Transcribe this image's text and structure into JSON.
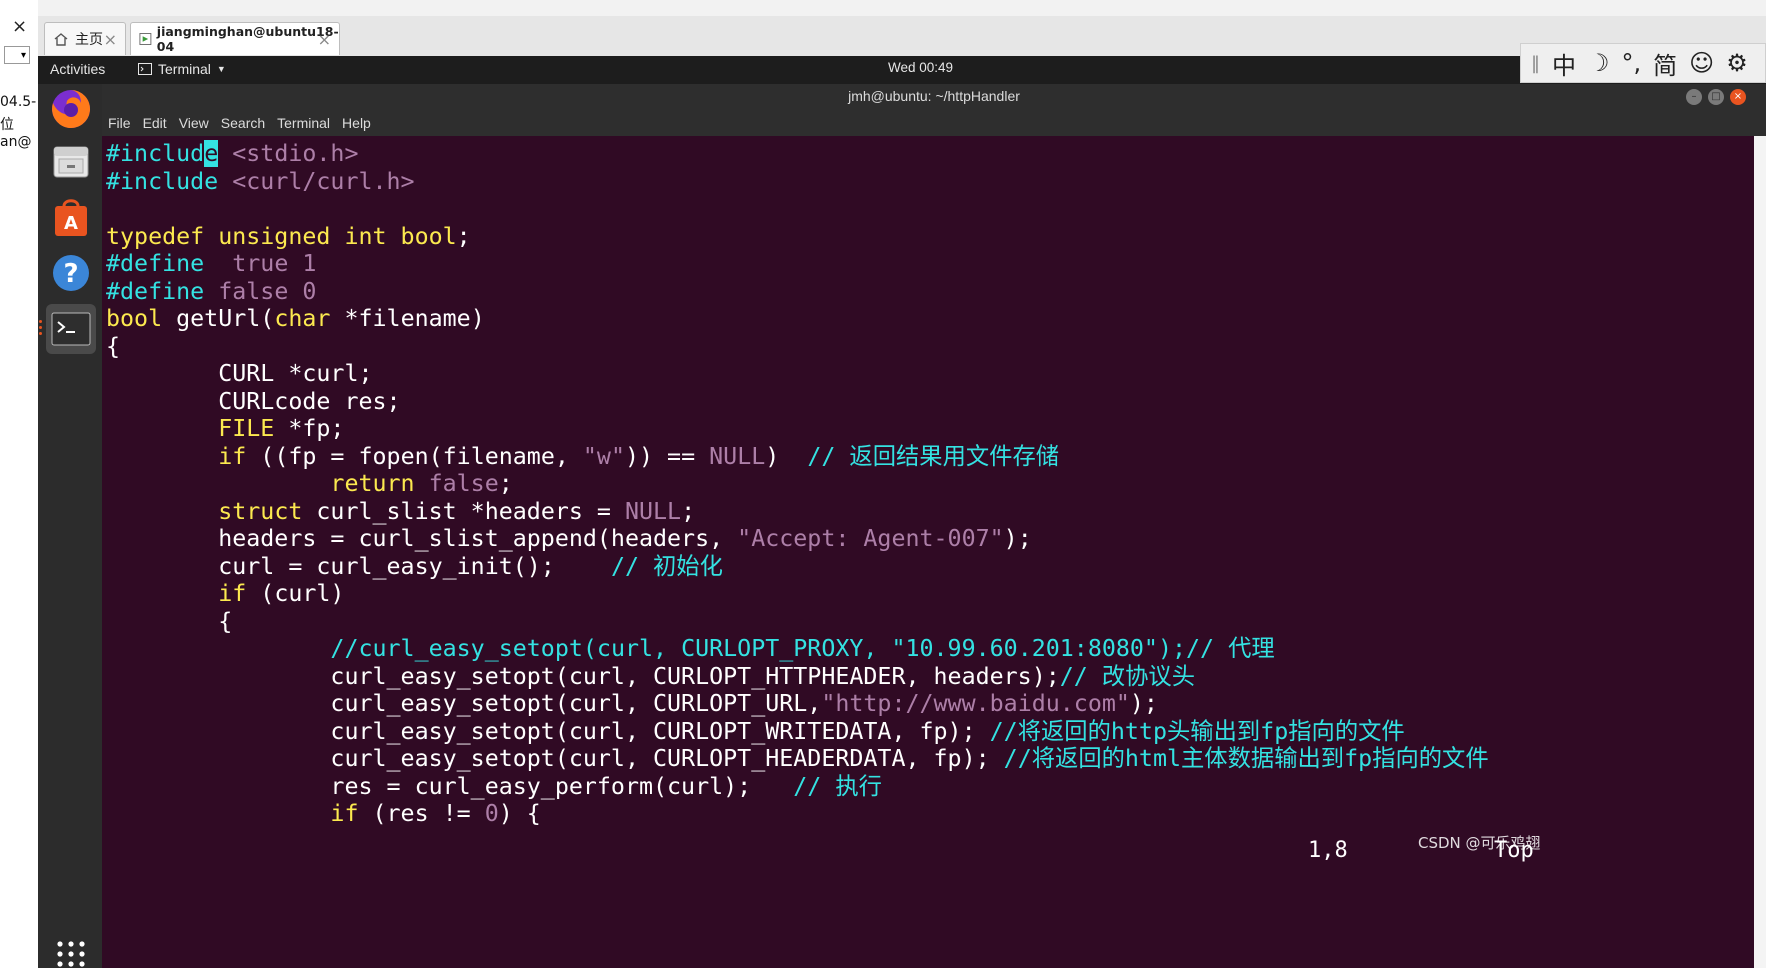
{
  "host": {
    "close_label": "×",
    "dropdown_label": "▾",
    "left_fragments": [
      "04.5-",
      "位",
      "an@"
    ]
  },
  "vm_tabs": [
    {
      "label": "主页"
    },
    {
      "label": "jiangminghan@ubuntu18-04"
    }
  ],
  "topbar": {
    "activities": "Activities",
    "app_menu": "Terminal",
    "clock": "Wed 00:49"
  },
  "ime": {
    "mode": "中",
    "moon": "☽",
    "punct": "°,",
    "script": "简",
    "emoji": "☺",
    "settings": "⚙"
  },
  "dock": {
    "items": [
      "firefox",
      "files",
      "software-center",
      "help",
      "terminal"
    ]
  },
  "terminal": {
    "title": "jmh@ubuntu: ~/httpHandler",
    "menu": [
      "File",
      "Edit",
      "View",
      "Search",
      "Terminal",
      "Help"
    ],
    "status_position": "1,8",
    "status_scroll": "Top"
  },
  "code_lines": [
    [
      [
        "pp",
        "#includ"
      ],
      [
        "cursor",
        "e"
      ],
      [
        "plain",
        " "
      ],
      [
        "hdr",
        "<stdio.h>"
      ]
    ],
    [
      [
        "pp",
        "#include"
      ],
      [
        "plain",
        " "
      ],
      [
        "hdr",
        "<curl/curl.h>"
      ]
    ],
    [],
    [
      [
        "k1",
        "typedef unsigned int bool"
      ],
      [
        "plain",
        ";"
      ]
    ],
    [
      [
        "pp",
        "#define"
      ],
      [
        "plain",
        "  "
      ],
      [
        "k2",
        "true 1"
      ]
    ],
    [
      [
        "pp",
        "#define"
      ],
      [
        "plain",
        " "
      ],
      [
        "k2",
        "false 0"
      ]
    ],
    [
      [
        "k1",
        "bool"
      ],
      [
        "plain",
        " getUrl("
      ],
      [
        "k1",
        "char"
      ],
      [
        "plain",
        " *filename)"
      ]
    ],
    [
      [
        "plain",
        "{"
      ]
    ],
    [
      [
        "plain",
        "        CURL *curl;"
      ]
    ],
    [
      [
        "plain",
        "        CURLcode res;"
      ]
    ],
    [
      [
        "plain",
        "        "
      ],
      [
        "k1",
        "FILE"
      ],
      [
        "plain",
        " *fp;"
      ]
    ],
    [
      [
        "plain",
        "        "
      ],
      [
        "k1",
        "if"
      ],
      [
        "plain",
        " ((fp = fopen(filename, "
      ],
      [
        "k2",
        "\"w\""
      ],
      [
        "plain",
        ")) == "
      ],
      [
        "k2",
        "NULL"
      ],
      [
        "plain",
        ")  "
      ],
      [
        "pp",
        "// 返回结果用文件存储"
      ]
    ],
    [
      [
        "plain",
        "                "
      ],
      [
        "k1",
        "return"
      ],
      [
        "plain",
        " "
      ],
      [
        "k2",
        "false"
      ],
      [
        "plain",
        ";"
      ]
    ],
    [
      [
        "plain",
        "        "
      ],
      [
        "k1",
        "struct"
      ],
      [
        "plain",
        " curl_slist *headers = "
      ],
      [
        "k2",
        "NULL"
      ],
      [
        "plain",
        ";"
      ]
    ],
    [
      [
        "plain",
        "        headers = curl_slist_append(headers, "
      ],
      [
        "k2",
        "\"Accept: Agent-007\""
      ],
      [
        "plain",
        ");"
      ]
    ],
    [
      [
        "plain",
        "        curl = curl_easy_init();    "
      ],
      [
        "pp",
        "// 初始化"
      ]
    ],
    [
      [
        "plain",
        "        "
      ],
      [
        "k1",
        "if"
      ],
      [
        "plain",
        " (curl)"
      ]
    ],
    [
      [
        "plain",
        "        {"
      ]
    ],
    [
      [
        "plain",
        "                "
      ],
      [
        "pp",
        "//curl_easy_setopt(curl, CURLOPT_PROXY, \"10.99.60.201:8080\");// 代理"
      ]
    ],
    [
      [
        "plain",
        "                curl_easy_setopt(curl, CURLOPT_HTTPHEADER, headers);"
      ],
      [
        "pp",
        "// 改协议头"
      ]
    ],
    [
      [
        "plain",
        "                curl_easy_setopt(curl, CURLOPT_URL,"
      ],
      [
        "k2",
        "\"http://www.baidu.com\""
      ],
      [
        "plain",
        ");"
      ]
    ],
    [
      [
        "plain",
        "                curl_easy_setopt(curl, CURLOPT_WRITEDATA, fp); "
      ],
      [
        "pp",
        "//将返回的http头输出到fp指向的文件"
      ]
    ],
    [
      [
        "plain",
        "                curl_easy_setopt(curl, CURLOPT_HEADERDATA, fp); "
      ],
      [
        "pp",
        "//将返回的html主体数据输出到fp指向的文件"
      ]
    ],
    [
      [
        "plain",
        "                res = curl_easy_perform(curl);   "
      ],
      [
        "pp",
        "// 执行"
      ]
    ],
    [
      [
        "plain",
        "                "
      ],
      [
        "k1",
        "if"
      ],
      [
        "plain",
        " (res != "
      ],
      [
        "k2",
        "0"
      ],
      [
        "plain",
        ") {"
      ]
    ]
  ],
  "watermark": "CSDN @可乐鸡翅"
}
